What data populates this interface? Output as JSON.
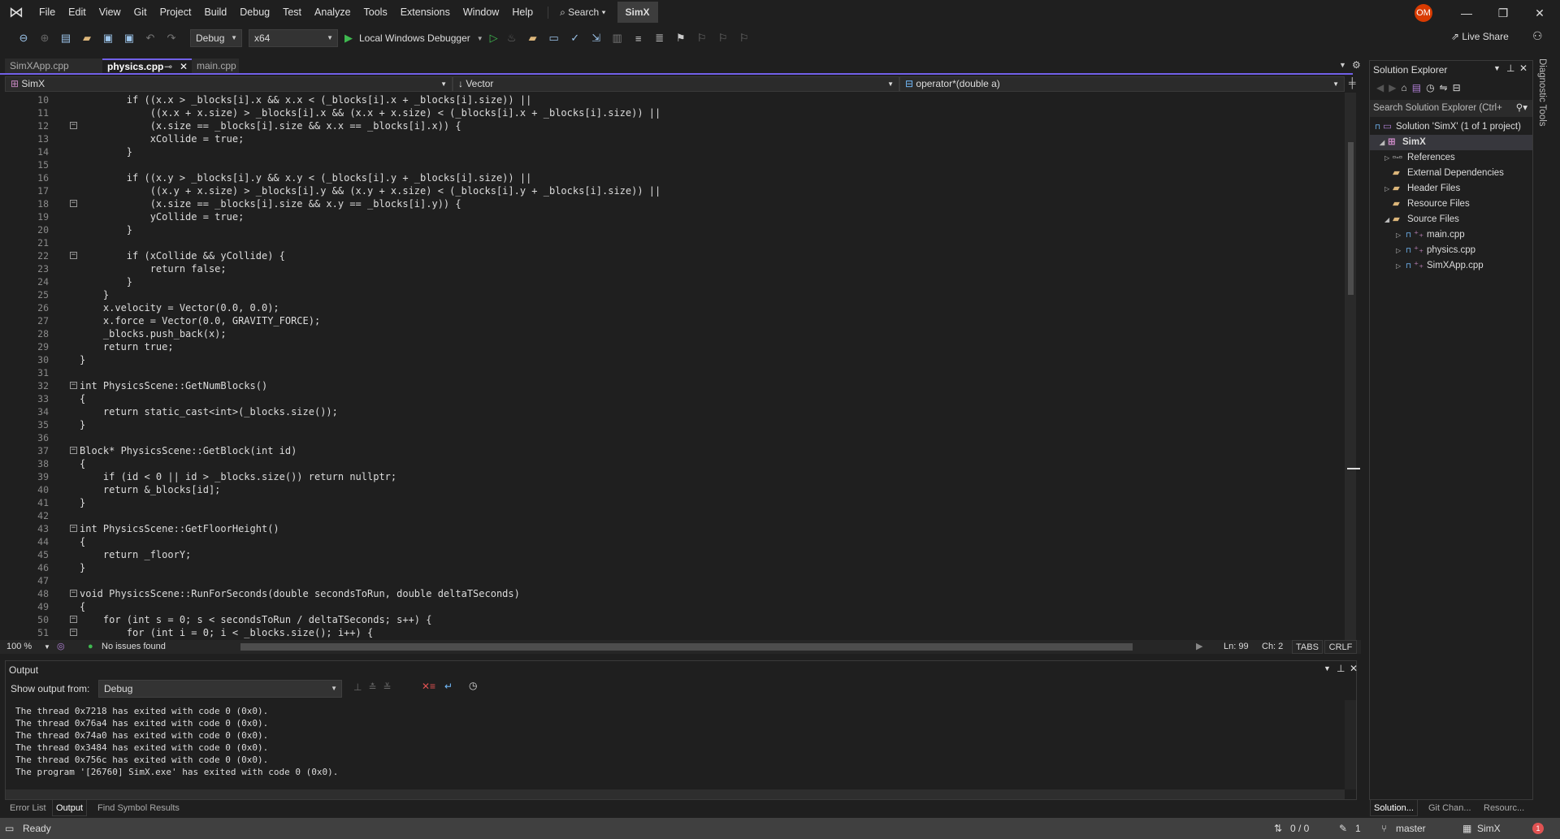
{
  "app": {
    "logo": "visual-studio-logo",
    "solution_name": "SimX",
    "accent": "#7160e8"
  },
  "menu": [
    "File",
    "Edit",
    "View",
    "Git",
    "Project",
    "Build",
    "Debug",
    "Test",
    "Analyze",
    "Tools",
    "Extensions",
    "Window",
    "Help"
  ],
  "search_label": "Search",
  "user_initials": "OM",
  "toolbar": {
    "configuration": "Debug",
    "platform": "x64",
    "debugger": "Local Windows Debugger",
    "live_share": "Live Share"
  },
  "tabs": [
    {
      "label": "SimXApp.cpp",
      "active": false
    },
    {
      "label": "physics.cpp",
      "active": true
    },
    {
      "label": "main.cpp",
      "active": false
    }
  ],
  "navbar": {
    "project": "SimX",
    "scope": "Vector",
    "member": "operator*(double a)"
  },
  "editor": {
    "first_line": 10,
    "fold_lines": [
      12,
      18,
      22,
      32,
      37,
      43,
      48,
      50,
      51
    ],
    "lines": [
      "        if ((x.x > _blocks[i].x && x.x < (_blocks[i].x + _blocks[i].size)) ||",
      "            ((x.x + x.size) > _blocks[i].x && (x.x + x.size) < (_blocks[i].x + _blocks[i].size)) ||",
      "            (x.size == _blocks[i].size && x.x == _blocks[i].x)) {",
      "            xCollide = true;",
      "        }",
      "",
      "        if ((x.y > _blocks[i].y && x.y < (_blocks[i].y + _blocks[i].size)) ||",
      "            ((x.y + x.size) > _blocks[i].y && (x.y + x.size) < (_blocks[i].y + _blocks[i].size)) ||",
      "            (x.size == _blocks[i].size && x.y == _blocks[i].y)) {",
      "            yCollide = true;",
      "        }",
      "",
      "        if (xCollide && yCollide) {",
      "            return false;",
      "        }",
      "    }",
      "    x.velocity = Vector(0.0, 0.0);",
      "    x.force = Vector(0.0, GRAVITY_FORCE);",
      "    _blocks.push_back(x);",
      "    return true;",
      "}",
      "",
      "int PhysicsScene::GetNumBlocks()",
      "{",
      "    return static_cast<int>(_blocks.size());",
      "}",
      "",
      "Block* PhysicsScene::GetBlock(int id)",
      "{",
      "    if (id < 0 || id > _blocks.size()) return nullptr;",
      "    return &_blocks[id];",
      "}",
      "",
      "int PhysicsScene::GetFloorHeight()",
      "{",
      "    return _floorY;",
      "}",
      "",
      "void PhysicsScene::RunForSeconds(double secondsToRun, double deltaTSeconds)",
      "{",
      "    for (int s = 0; s < secondsToRun / deltaTSeconds; s++) {",
      "        for (int i = 0; i < _blocks.size(); i++) {"
    ]
  },
  "editor_status": {
    "zoom": "100 %",
    "issues": "No issues found",
    "line": "Ln: 99",
    "col": "Ch: 2",
    "indent": "TABS",
    "eol": "CRLF"
  },
  "output": {
    "title": "Output",
    "show_from_label": "Show output from:",
    "source": "Debug",
    "lines": [
      "The thread 0x7218 has exited with code 0 (0x0).",
      "The thread 0x76a4 has exited with code 0 (0x0).",
      "The thread 0x74a0 has exited with code 0 (0x0).",
      "The thread 0x3484 has exited with code 0 (0x0).",
      "The thread 0x756c has exited with code 0 (0x0).",
      "The program '[26760] SimX.exe' has exited with code 0 (0x0)."
    ]
  },
  "bottom_tabs": [
    "Error List",
    "Output",
    "Find Symbol Results"
  ],
  "solution_explorer": {
    "title": "Solution Explorer",
    "search_placeholder": "Search Solution Explorer (Ctrl+",
    "items": [
      {
        "label": "Solution 'SimX' (1 of 1 project)",
        "depth": 0,
        "icon": "solution-icon"
      },
      {
        "label": "SimX",
        "depth": 1,
        "icon": "project-icon",
        "expanded": true,
        "selected": true
      },
      {
        "label": "References",
        "depth": 2,
        "icon": "references-icon",
        "expander": "collapsed"
      },
      {
        "label": "External Dependencies",
        "depth": 2,
        "icon": "folder-icon"
      },
      {
        "label": "Header Files",
        "depth": 2,
        "icon": "filter-folder-icon",
        "expander": "collapsed"
      },
      {
        "label": "Resource Files",
        "depth": 2,
        "icon": "filter-folder-icon"
      },
      {
        "label": "Source Files",
        "depth": 2,
        "icon": "filter-folder-icon",
        "expander": "expanded"
      },
      {
        "label": "main.cpp",
        "depth": 3,
        "icon": "cpp-file-icon",
        "expander": "collapsed"
      },
      {
        "label": "physics.cpp",
        "depth": 3,
        "icon": "cpp-file-icon",
        "expander": "collapsed"
      },
      {
        "label": "SimXApp.cpp",
        "depth": 3,
        "icon": "cpp-file-icon",
        "expander": "collapsed"
      }
    ]
  },
  "side_tabs": [
    "Solution...",
    "Git Chan...",
    "Resourc..."
  ],
  "diagnostic_tools": "Diagnostic Tools",
  "statusbar": {
    "ready": "Ready",
    "sync": "0 / 0",
    "changes": "1",
    "branch": "master",
    "repo": "SimX",
    "notifications": "1"
  }
}
